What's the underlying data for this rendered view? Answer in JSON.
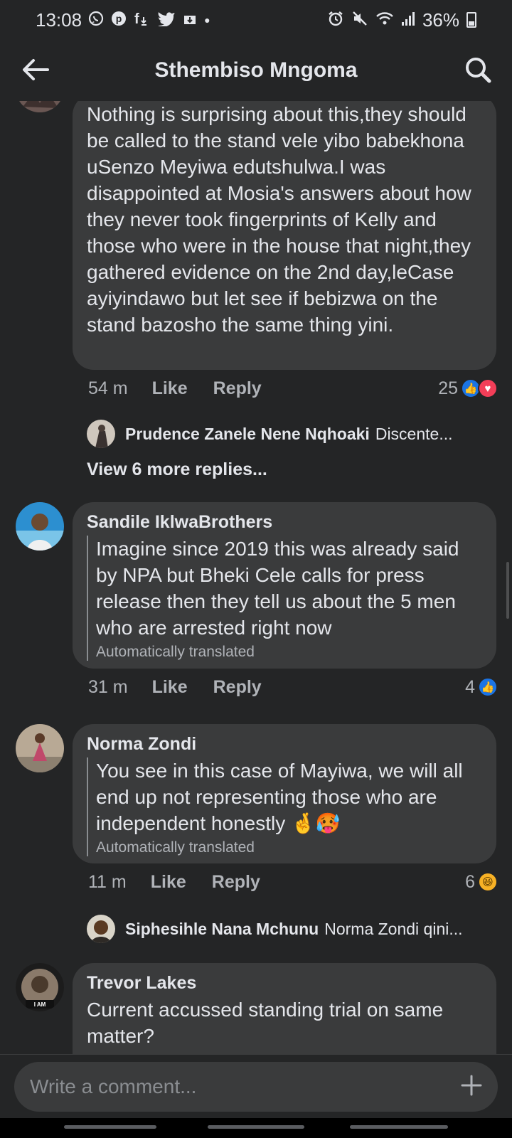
{
  "status_bar": {
    "time": "13:08",
    "notif_icons": [
      "whatsapp-icon",
      "pinterest-icon",
      "facebook-download-icon",
      "twitter-icon",
      "download-icon"
    ],
    "battery": "36%",
    "battery_level": 0.36
  },
  "header": {
    "title": "Sthembiso Mngoma"
  },
  "comments": [
    {
      "author": "",
      "text": "Nothing is surprising about this,they should be called to the stand vele yibo babekhona uSenzo Meyiwa edutshulwa.I was disappointed at Mosia's answers about how they never took fingerprints of Kelly and those who were in the house that night,they gathered evidence on the 2nd day,leCase ayiyindawo but let see if bebizwa on the stand bazosho the same thing yini.",
      "time": "54 m",
      "like_label": "Like",
      "reply_label": "Reply",
      "reaction_count": "25",
      "reactions": [
        "like",
        "love"
      ],
      "reply_preview": {
        "name": "Prudence Zanele Nene Nqhoaki",
        "snippet": "Discente..."
      },
      "view_more": "View 6 more replies..."
    },
    {
      "author": "Sandile IklwaBrothers",
      "text": "Imagine since 2019 this was already said by NPA but Bheki Cele calls for press release then they tell us about the 5 men who are arrested right now",
      "translated_note": "Automatically translated",
      "time": "31 m",
      "like_label": "Like",
      "reply_label": "Reply",
      "reaction_count": "4",
      "reactions": [
        "like"
      ]
    },
    {
      "author": "Norma Zondi",
      "text": "You see in this case of Mayiwa, we will all end up not representing those who are independent honestly 🤞🥵",
      "translated_note": "Automatically translated",
      "time": "11 m",
      "like_label": "Like",
      "reply_label": "Reply",
      "reaction_count": "6",
      "reactions": [
        "haha"
      ],
      "reply_preview": {
        "name": "Siphesihle Nana Mchunu",
        "snippet": "Norma Zondi qini..."
      }
    },
    {
      "author": "Trevor Lakes",
      "text": "Current accussed standing trial on same matter?"
    }
  ],
  "composer": {
    "placeholder": "Write a comment...",
    "plus_icon": "plus-icon"
  },
  "colors": {
    "background": "#242526",
    "bubble": "#3a3b3c",
    "text": "#e4e6eb",
    "secondary": "#b0b3b8",
    "like_blue": "#1b74e4",
    "love_red": "#f33e58"
  }
}
